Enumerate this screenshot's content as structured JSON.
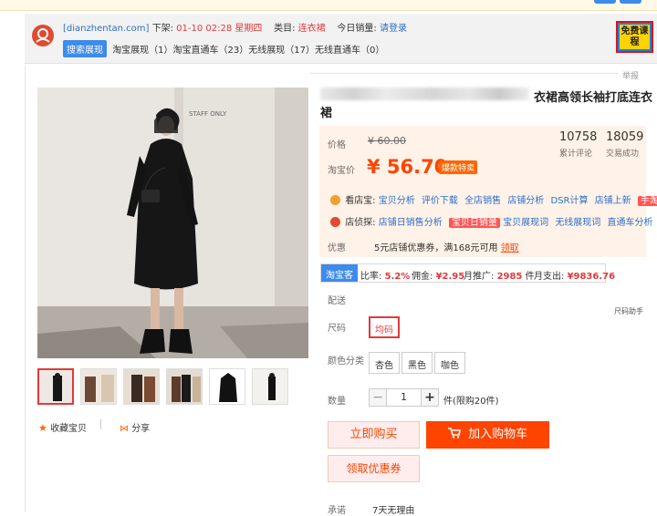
{
  "ext": {
    "site": "[dianzhentan.com]",
    "delist_label": "下架:",
    "delist_time": "01-10 02:28 星期四",
    "category_label": "类目:",
    "category": "连衣裙",
    "sales_label": "今日销量:",
    "sales_login": "请登录",
    "search_badge": "搜索展现",
    "stats": "淘宝展现（1）淘宝直通车（23）无线展现（17）无线直通车（0）",
    "free_course": "免费课程"
  },
  "report": "举报",
  "title": {
    "visible_end": "衣裙高领长袖打底连衣",
    "line2": "裙"
  },
  "price": {
    "label": "价格",
    "old_value": "¥ 60.00",
    "tb_label": "淘宝价",
    "tb_value": "¥ 56.70",
    "hot_tag": "爆款特卖",
    "reviews_count": "10758",
    "reviews_label": "累计评论",
    "deals_count": "18059",
    "deals_label": "交易成功"
  },
  "tools": {
    "row1_label": "看店宝:",
    "row1": [
      "宝贝分析",
      "评价下载",
      "全店销售",
      "店铺分析",
      "DSR计算",
      "店铺上新"
    ],
    "row1_tag": "手淘预览",
    "row2_label": "店侦探:",
    "row2": [
      "店铺日销售分析"
    ],
    "row2_tag": "宝贝日销量",
    "row2_rest": [
      "宝贝展现词",
      "无线展现词",
      "直通车分析"
    ]
  },
  "coupon": {
    "label": "优惠",
    "text": "5元店铺优惠券，满168元可用",
    "link": "领取"
  },
  "ztc": {
    "tag": "淘宝客",
    "ratio_label": "比率:",
    "ratio": "5.2%",
    "commission_label": "佣金:",
    "commission": "¥2.95",
    "monthly_label": "月推广:",
    "monthly": "2985",
    "monthly_unit": "件",
    "spend_label": "月支出:",
    "spend": "¥9836.76"
  },
  "shipping_label": "配送",
  "size": {
    "label": "尺码",
    "selected": "均码",
    "helper": "尺码助手"
  },
  "color": {
    "label": "颜色分类",
    "options": [
      "杏色",
      "黑色",
      "咖色"
    ]
  },
  "qty": {
    "label": "数量",
    "value": "1",
    "minus": "−",
    "plus": "+",
    "limit": "件(限购20件)"
  },
  "buttons": {
    "buy_now": "立即购买",
    "add_cart": "加入购物车",
    "get_coupon": "领取优惠券"
  },
  "promise": {
    "label": "承诺",
    "text": "7天无理由"
  },
  "gallery": {
    "fav": "收藏宝贝",
    "share": "分享",
    "wall_sign": "STAFF ONLY"
  },
  "colors": {
    "accent": "#ff4400",
    "link": "#2d6ec9",
    "price_bg": "#fff2e8"
  }
}
